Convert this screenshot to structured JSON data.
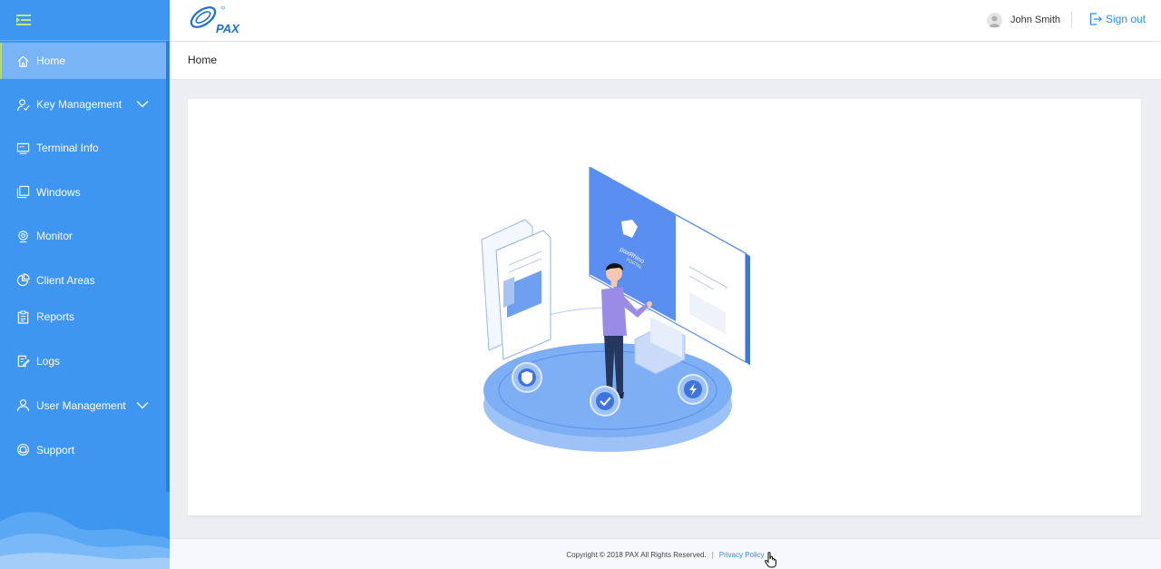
{
  "sidebar": {
    "items": [
      {
        "label": "Home",
        "icon": "home-icon"
      },
      {
        "label": "Key Management",
        "icon": "key-user-icon"
      },
      {
        "label": "Terminal Info",
        "icon": "monitor-icon"
      },
      {
        "label": "Windows",
        "icon": "windows-icon"
      },
      {
        "label": "Monitor",
        "icon": "camera-icon"
      },
      {
        "label": "Client Areas",
        "icon": "pie-chart-icon"
      },
      {
        "label": "Reports",
        "icon": "clipboard-icon"
      },
      {
        "label": "Logs",
        "icon": "edit-doc-icon"
      },
      {
        "label": "User Management",
        "icon": "user-icon"
      },
      {
        "label": "Support",
        "icon": "support-icon"
      }
    ]
  },
  "header": {
    "logo_text": "PAX",
    "user_name": "John Smith",
    "signout_label": "Sign out"
  },
  "breadcrumb": {
    "current": "Home"
  },
  "hero": {
    "brand": "paxRhino",
    "sub": "PORTAL"
  },
  "footer": {
    "copyright": "Copyright © 2018 PAX All Rights Reserved.",
    "separator": "|",
    "privacy_label": "Privacy Policy"
  },
  "colors": {
    "sidebar_bg": "#3f96f1",
    "active_item_bg": "#79b5f6",
    "active_indicator": "#b5d96c",
    "link": "#2d8cf0"
  }
}
